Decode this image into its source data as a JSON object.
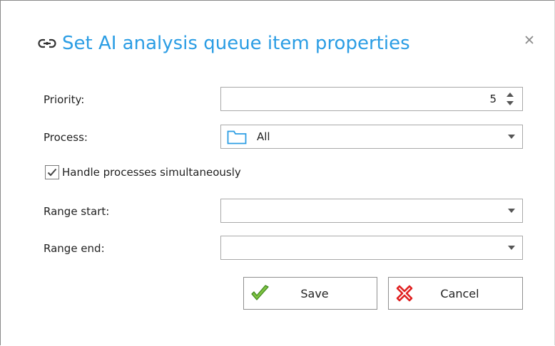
{
  "dialog": {
    "title": "Set AI analysis queue item properties",
    "title_icon": "link-icon",
    "close_label": "×"
  },
  "form": {
    "priority_label": "Priority:",
    "priority_value": "5",
    "process_label": "Process:",
    "process_value": "All",
    "process_icon": "folder-icon",
    "handle_simultaneously_label": "Handle processes simultaneously",
    "handle_simultaneously_checked": true,
    "range_start_label": "Range start:",
    "range_start_value": "",
    "range_end_label": "Range end:",
    "range_end_value": ""
  },
  "buttons": {
    "save_label": "Save",
    "cancel_label": "Cancel"
  },
  "colors": {
    "title": "#2b9de4",
    "save_icon": "#5aa832",
    "cancel_icon": "#e02020",
    "folder_icon": "#2b9de4"
  }
}
